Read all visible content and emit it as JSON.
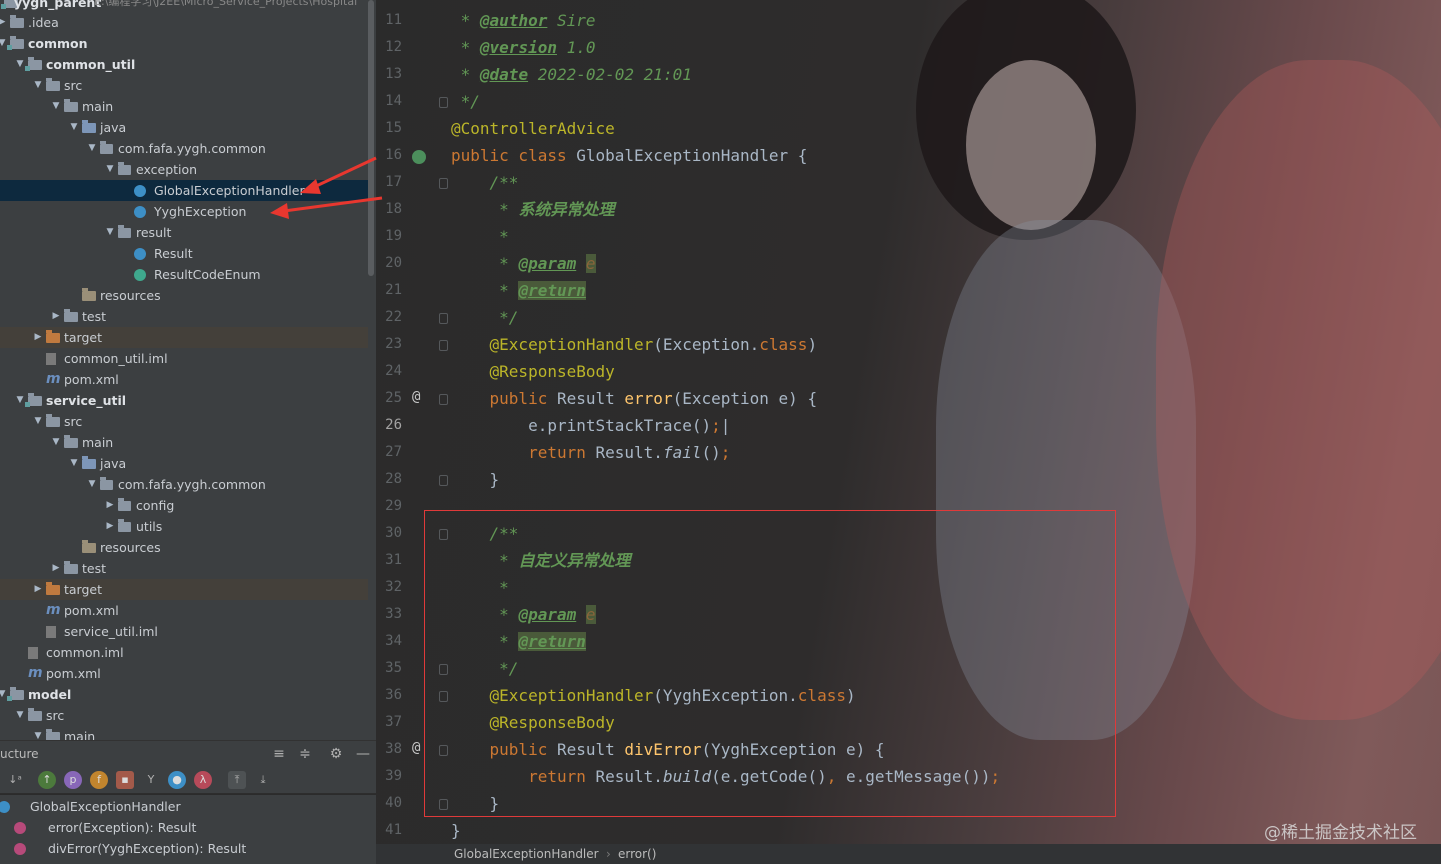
{
  "project_tree": {
    "root": {
      "label": "yygh_parent",
      "path": "E:\\编程学习\\J2EE\\Micro_Service_Projects\\Hospital"
    },
    "items": [
      {
        "label": ".idea",
        "indent": 0,
        "kind": "folder",
        "arrow": "collapsed"
      },
      {
        "label": "common",
        "indent": 0,
        "kind": "module",
        "arrow": "expanded",
        "bold": true
      },
      {
        "label": "common_util",
        "indent": 1,
        "kind": "module",
        "arrow": "expanded",
        "bold": true
      },
      {
        "label": "src",
        "indent": 2,
        "kind": "folder",
        "arrow": "expanded"
      },
      {
        "label": "main",
        "indent": 3,
        "kind": "folder",
        "arrow": "expanded"
      },
      {
        "label": "java",
        "indent": 4,
        "kind": "src",
        "arrow": "expanded"
      },
      {
        "label": "com.fafa.yygh.common",
        "indent": 5,
        "kind": "pkg",
        "arrow": "expanded"
      },
      {
        "label": "exception",
        "indent": 6,
        "kind": "pkg",
        "arrow": "expanded"
      },
      {
        "label": "GlobalExceptionHandler",
        "indent": 7,
        "kind": "class",
        "selected": true
      },
      {
        "label": "YyghException",
        "indent": 7,
        "kind": "exc"
      },
      {
        "label": "result",
        "indent": 6,
        "kind": "pkg",
        "arrow": "expanded"
      },
      {
        "label": "Result",
        "indent": 7,
        "kind": "class"
      },
      {
        "label": "ResultCodeEnum",
        "indent": 7,
        "kind": "enum"
      },
      {
        "label": "resources",
        "indent": 4,
        "kind": "res"
      },
      {
        "label": "test",
        "indent": 3,
        "kind": "folder",
        "arrow": "collapsed"
      },
      {
        "label": "target",
        "indent": 2,
        "kind": "target",
        "arrow": "collapsed",
        "band": true
      },
      {
        "label": "common_util.iml",
        "indent": 2,
        "kind": "iml"
      },
      {
        "label": "pom.xml",
        "indent": 2,
        "kind": "maven"
      },
      {
        "label": "service_util",
        "indent": 1,
        "kind": "module",
        "arrow": "expanded",
        "bold": true
      },
      {
        "label": "src",
        "indent": 2,
        "kind": "folder",
        "arrow": "expanded"
      },
      {
        "label": "main",
        "indent": 3,
        "kind": "folder",
        "arrow": "expanded"
      },
      {
        "label": "java",
        "indent": 4,
        "kind": "src",
        "arrow": "expanded"
      },
      {
        "label": "com.fafa.yygh.common",
        "indent": 5,
        "kind": "pkg",
        "arrow": "expanded"
      },
      {
        "label": "config",
        "indent": 6,
        "kind": "pkg",
        "arrow": "collapsed"
      },
      {
        "label": "utils",
        "indent": 6,
        "kind": "pkg",
        "arrow": "collapsed"
      },
      {
        "label": "resources",
        "indent": 4,
        "kind": "res"
      },
      {
        "label": "test",
        "indent": 3,
        "kind": "folder",
        "arrow": "collapsed"
      },
      {
        "label": "target",
        "indent": 2,
        "kind": "target",
        "arrow": "collapsed",
        "band": true
      },
      {
        "label": "pom.xml",
        "indent": 2,
        "kind": "maven"
      },
      {
        "label": "service_util.iml",
        "indent": 2,
        "kind": "iml"
      },
      {
        "label": "common.iml",
        "indent": 1,
        "kind": "iml"
      },
      {
        "label": "pom.xml",
        "indent": 1,
        "kind": "maven"
      },
      {
        "label": "model",
        "indent": 0,
        "kind": "module",
        "arrow": "expanded",
        "bold": true
      },
      {
        "label": "src",
        "indent": 1,
        "kind": "folder",
        "arrow": "expanded"
      },
      {
        "label": "main",
        "indent": 2,
        "kind": "folder",
        "arrow": "expanded"
      }
    ]
  },
  "structure": {
    "title": "ucture",
    "toolbar": [
      "sort-alpha-icon",
      "inherited-icon",
      "properties-icon",
      "fields-icon",
      "non-public-icon",
      "lambda-icon",
      "anonymous-icon",
      "lambda-icon",
      "expand-icon",
      "collapse-icon"
    ],
    "items": [
      {
        "label": "GlobalExceptionHandler",
        "kind": "class"
      },
      {
        "label": "error(Exception): Result",
        "kind": "method"
      },
      {
        "label": "divError(YyghException): Result",
        "kind": "method"
      }
    ]
  },
  "editor": {
    "lines": [
      {
        "n": "11",
        "html": "<span class=\"c-doc\"> * </span><span class=\"c-tag\">@author</span><span class=\"c-doc\"> Sire</span>"
      },
      {
        "n": "12",
        "html": "<span class=\"c-doc\"> * </span><span class=\"c-tag\">@version</span><span class=\"c-doc\"> 1.0</span>"
      },
      {
        "n": "13",
        "html": "<span class=\"c-doc\"> * </span><span class=\"c-tag\">@date</span><span class=\"c-doc\"> 2022-02-02 21:01</span>"
      },
      {
        "n": "14",
        "html": "<span class=\"c-doc\"> */</span>"
      },
      {
        "n": "15",
        "html": "<span class=\"c-ann\">@ControllerAdvice</span>"
      },
      {
        "n": "16",
        "html": "<span class=\"c-kw\">public class </span>GlobalExceptionHandler {"
      },
      {
        "n": "17",
        "html": "    <span class=\"c-doc\">/**</span>"
      },
      {
        "n": "18",
        "html": "<span class=\"c-doc\">     * </span><span class=\"c-cn\">系统异常处理</span>"
      },
      {
        "n": "19",
        "html": "<span class=\"c-doc\">     *</span>"
      },
      {
        "n": "20",
        "html": "<span class=\"c-doc\">     * </span><span class=\"c-tag\">@param</span><span class=\"c-doc\"> </span><span class=\"c-tagval c-hl\">e</span>"
      },
      {
        "n": "21",
        "html": "<span class=\"c-doc\">     * </span><span class=\"c-tag c-hl\">@return</span>"
      },
      {
        "n": "22",
        "html": "<span class=\"c-doc\">     */</span>"
      },
      {
        "n": "23",
        "html": "    <span class=\"c-ann\">@ExceptionHandler</span>(Exception.<span class=\"c-kw\">class</span>)"
      },
      {
        "n": "24",
        "html": "    <span class=\"c-ann\">@ResponseBody</span>"
      },
      {
        "n": "25",
        "html": "    <span class=\"c-kw\">public </span>Result <span class=\"c-fn\">error</span>(Exception e) {"
      },
      {
        "n": "26",
        "html": "        e.printStackTrace()<span class=\"c-kw\">;</span>|"
      },
      {
        "n": "27",
        "html": "        <span class=\"c-kw\">return </span>Result.<span class=\"c-it\">fail</span>()<span class=\"c-kw\">;</span>"
      },
      {
        "n": "28",
        "html": "    }"
      },
      {
        "n": "29",
        "html": ""
      },
      {
        "n": "30",
        "html": "    <span class=\"c-doc\">/**</span>"
      },
      {
        "n": "31",
        "html": "<span class=\"c-doc\">     * </span><span class=\"c-cn\">自定义异常处理</span>"
      },
      {
        "n": "32",
        "html": "<span class=\"c-doc\">     *</span>"
      },
      {
        "n": "33",
        "html": "<span class=\"c-doc\">     * </span><span class=\"c-tag\">@param</span><span class=\"c-doc\"> </span><span class=\"c-tagval c-hl\">e</span>"
      },
      {
        "n": "34",
        "html": "<span class=\"c-doc\">     * </span><span class=\"c-tag c-hl\">@return</span>"
      },
      {
        "n": "35",
        "html": "<span class=\"c-doc\">     */</span>"
      },
      {
        "n": "36",
        "html": "    <span class=\"c-ann\">@ExceptionHandler</span>(YyghException.<span class=\"c-kw\">class</span>)"
      },
      {
        "n": "37",
        "html": "    <span class=\"c-ann\">@ResponseBody</span>"
      },
      {
        "n": "38",
        "html": "    <span class=\"c-kw\">public </span>Result <span class=\"c-fn\">divError</span>(YyghException e) {"
      },
      {
        "n": "39",
        "html": "        <span class=\"c-kw\">return </span>Result.<span class=\"c-it\">build</span>(e.getCode()<span class=\"c-kw\">, </span>e.getMessage())<span class=\"c-kw\">;</span>"
      },
      {
        "n": "40",
        "html": "    }"
      },
      {
        "n": "41",
        "html": "}"
      }
    ],
    "current_line": "26",
    "gutter_marks": {
      "16": "implemented-icon",
      "25": "override-at-icon",
      "38": "override-at-icon"
    }
  },
  "breadcrumb": {
    "class": "GlobalExceptionHandler",
    "method": "error()"
  },
  "watermark": "@稀土掘金技术社区",
  "colors": {
    "accent_red": "#e03a3a",
    "selection": "#0d293e"
  }
}
